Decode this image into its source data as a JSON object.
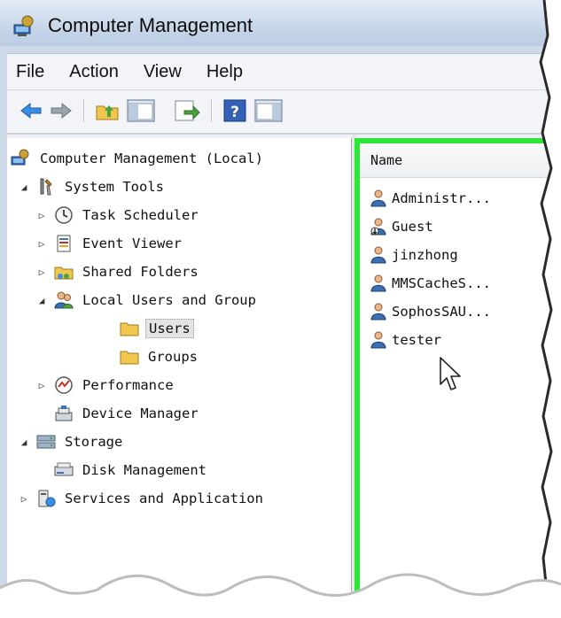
{
  "window": {
    "title": "Computer Management"
  },
  "menu": [
    "File",
    "Action",
    "View",
    "Help"
  ],
  "tree": {
    "root": "Computer Management (Local)",
    "system_tools": "System Tools",
    "task_scheduler": "Task Scheduler",
    "event_viewer": "Event Viewer",
    "shared_folders": "Shared Folders",
    "local_users": "Local Users and Group",
    "users": "Users",
    "groups": "Groups",
    "performance": "Performance",
    "device_manager": "Device Manager",
    "storage": "Storage",
    "disk_management": "Disk Management",
    "services": "Services and Application"
  },
  "list": {
    "column_name": "Name",
    "users": [
      "Administr...",
      "Guest",
      "jinzhong",
      "MMSCacheS...",
      "SophosSAU...",
      "tester"
    ]
  },
  "toolbar_icons": [
    "back-arrow-icon",
    "forward-arrow-icon",
    "up-folder-icon",
    "show-hide-tree-icon",
    "export-list-icon",
    "help-icon",
    "show-hide-action-pane-icon"
  ],
  "colors": {
    "selection_highlight": "#2ee63a",
    "title_bar": "#c7d6e9"
  }
}
